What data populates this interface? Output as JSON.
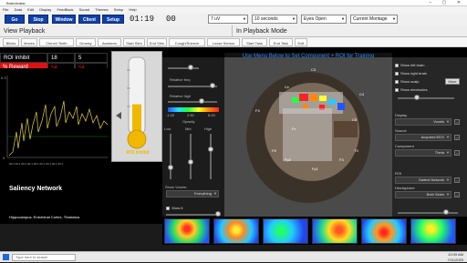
{
  "window": {
    "title": "BrainAvatar",
    "controls": "–  ▢  ✕"
  },
  "menu": [
    "File",
    "Data",
    "Edit",
    "Display",
    "FeedBack",
    "Sound",
    "Themes",
    "Setup",
    "Help"
  ],
  "toolbar": {
    "go": "Go",
    "stop": "Stop",
    "window": "Window",
    "client": "Client",
    "setup": "Setup",
    "timer1": "01:19",
    "timer2": "00",
    "dropdowns": [
      "7 uV",
      "10 seconds",
      "Eyes Open",
      "Current Montage"
    ]
  },
  "sections": {
    "left": "View Playback",
    "right": "In Playback Mode"
  },
  "nav": [
    "Blinks",
    "Moves",
    "Clench Teeth",
    "Drowsy",
    "Awakens",
    "Start Stim",
    "End Stim",
    "Cough/Sneeze",
    "Loose Sensor",
    "Start Task",
    "End Task",
    "Edit"
  ],
  "metrics": {
    "roi_inhibit_label": "ROI Inhibit",
    "roi_inhibit_a": "18",
    "roi_inhibit_b": "5",
    "reward_label": "% Reward",
    "reward_a": "54",
    "reward_b": "54"
  },
  "graph": {
    "y_top": "0.3",
    "y_bottom": "0",
    "x_labels": "00:1 00:1 00:1 00:1 00:1 00:1 00:1 00:1 00:1"
  },
  "thermometer": {
    "label": "ROI Inhibit",
    "level": 0.38
  },
  "banner": "Use Menu Below to Set Component + ROI for Training",
  "controls": {
    "relative_freq": "Relative freq",
    "relative_high": "Relative high",
    "scale_min": "-1.00",
    "scale_mid": "2.50",
    "scale_max": "6.00",
    "opacity": "Opacity",
    "low": "Low",
    "mid": "Mid",
    "high": "High",
    "show_voxels": "Show Voxels:",
    "voxels_value": "Everything",
    "glow": "Glow 6"
  },
  "electrodes": [
    "C3",
    "Cz",
    "C4",
    "F4",
    "Fz",
    "F8",
    "Fp2",
    "Fp1",
    "F3",
    "T3",
    "C5"
  ],
  "right_panel": {
    "show_left": "Show left brain",
    "show_right": "Show right brain",
    "show_scalp": "Show scalp",
    "more": "More",
    "show_electrodes": "Show electrodes",
    "display_label": "Display",
    "display_value": "Voxels",
    "source_label": "Source",
    "source_value": "Acquired EEG",
    "component_label": "Component",
    "component_value": "Theta",
    "roi_label": "ROI",
    "roi_value": "Salient Network",
    "hemisphere_label": "Hemisphere",
    "hemisphere_value": "Both Sides",
    "damping": "Damping",
    "damping_value": "LORETA"
  },
  "salience": {
    "title": "Saliency Network",
    "sub": "Hippocampus, Entorhinal Cortex, Thalamus"
  },
  "taskbar": {
    "search": "Type here to search",
    "time": "10:09 AM",
    "date": "7/11/2020"
  },
  "colors": {
    "brand": "#1040a8",
    "reward": "#e01010",
    "accent": "#2a8cff"
  }
}
